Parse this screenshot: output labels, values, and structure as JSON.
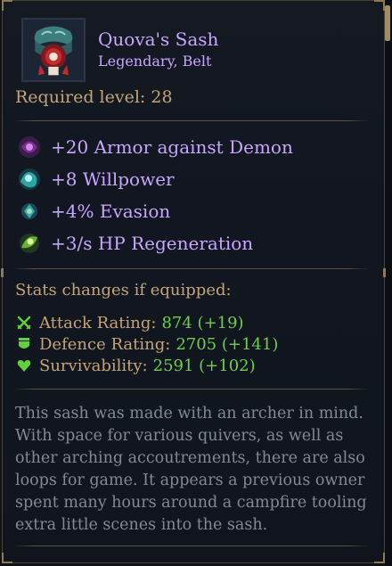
{
  "item": {
    "name": "Quova's Sash",
    "type": "Legendary, Belt",
    "required_level": "Required level: 28",
    "icon": "belt-icon"
  },
  "properties": [
    {
      "text": "+20 Armor against Demon",
      "icon": "demon-armor-gem-icon",
      "color": "#7a2f8f"
    },
    {
      "text": "+8 Willpower",
      "icon": "willpower-gem-icon",
      "color": "#2aa8a0"
    },
    {
      "text": "+4% Evasion",
      "icon": "evasion-gem-icon",
      "color": "#3aa8b0"
    },
    {
      "text": "+3/s HP Regeneration",
      "icon": "regeneration-gem-icon",
      "color": "#6ab035"
    }
  ],
  "stats": {
    "title": "Stats changes if equipped:",
    "rows": [
      {
        "label": "Attack Rating:",
        "value": "874 (+19)",
        "icon": "crossed-swords-icon"
      },
      {
        "label": "Defence Rating:",
        "value": "2705 (+141)",
        "icon": "shield-icon"
      },
      {
        "label": "Survivability:",
        "value": "2591 (+102)",
        "icon": "heart-icon"
      }
    ]
  },
  "description": [
    "This sash was made with an archer in mind.",
    "With space for various quivers, as well as",
    "other arching accoutrements, there are also",
    "loops for game. It appears a previous owner",
    "spent many hours around a campfire tooling",
    "extra little scenes into the sash."
  ],
  "colors": {
    "legendary": "#c9a6ff",
    "label": "#c5a577",
    "positive": "#6ed14a",
    "flavor": "#828a96"
  }
}
